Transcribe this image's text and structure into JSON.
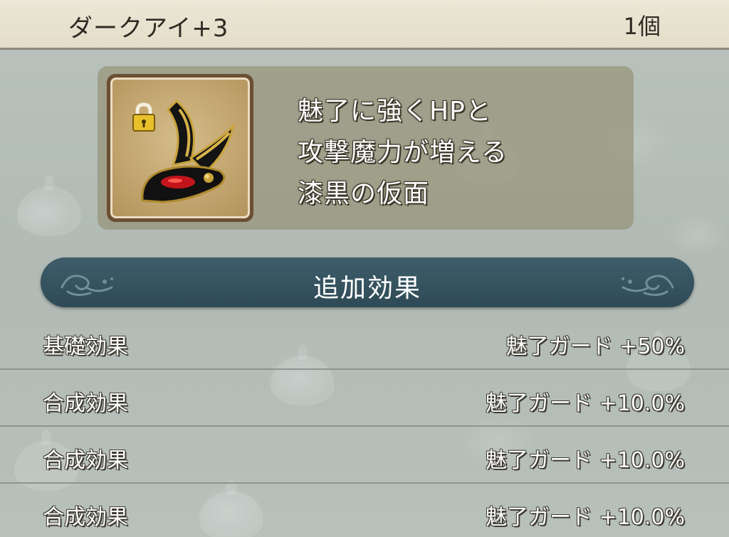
{
  "header": {
    "item_name": "ダークアイ+3",
    "item_count": "1個"
  },
  "item": {
    "icon": "mask-icon",
    "locked_icon": "lock-icon",
    "description_lines": [
      "魅了に強くHPと",
      "攻撃魔力が増える",
      "漆黒の仮面"
    ]
  },
  "section": {
    "title": "追加効果"
  },
  "effects": [
    {
      "label": "基礎効果",
      "value": "魅了ガード +50%"
    },
    {
      "label": "合成効果",
      "value": "魅了ガード +10.0%"
    },
    {
      "label": "合成効果",
      "value": "魅了ガード +10.0%"
    },
    {
      "label": "合成効果",
      "value": "魅了ガード +10.0%"
    }
  ],
  "colors": {
    "header_bg": "#e8e2d0",
    "section_bar": "#34505c",
    "panel_bg": "#969478",
    "lock_gold": "#e8c12a",
    "mask_red": "#c4141b"
  }
}
